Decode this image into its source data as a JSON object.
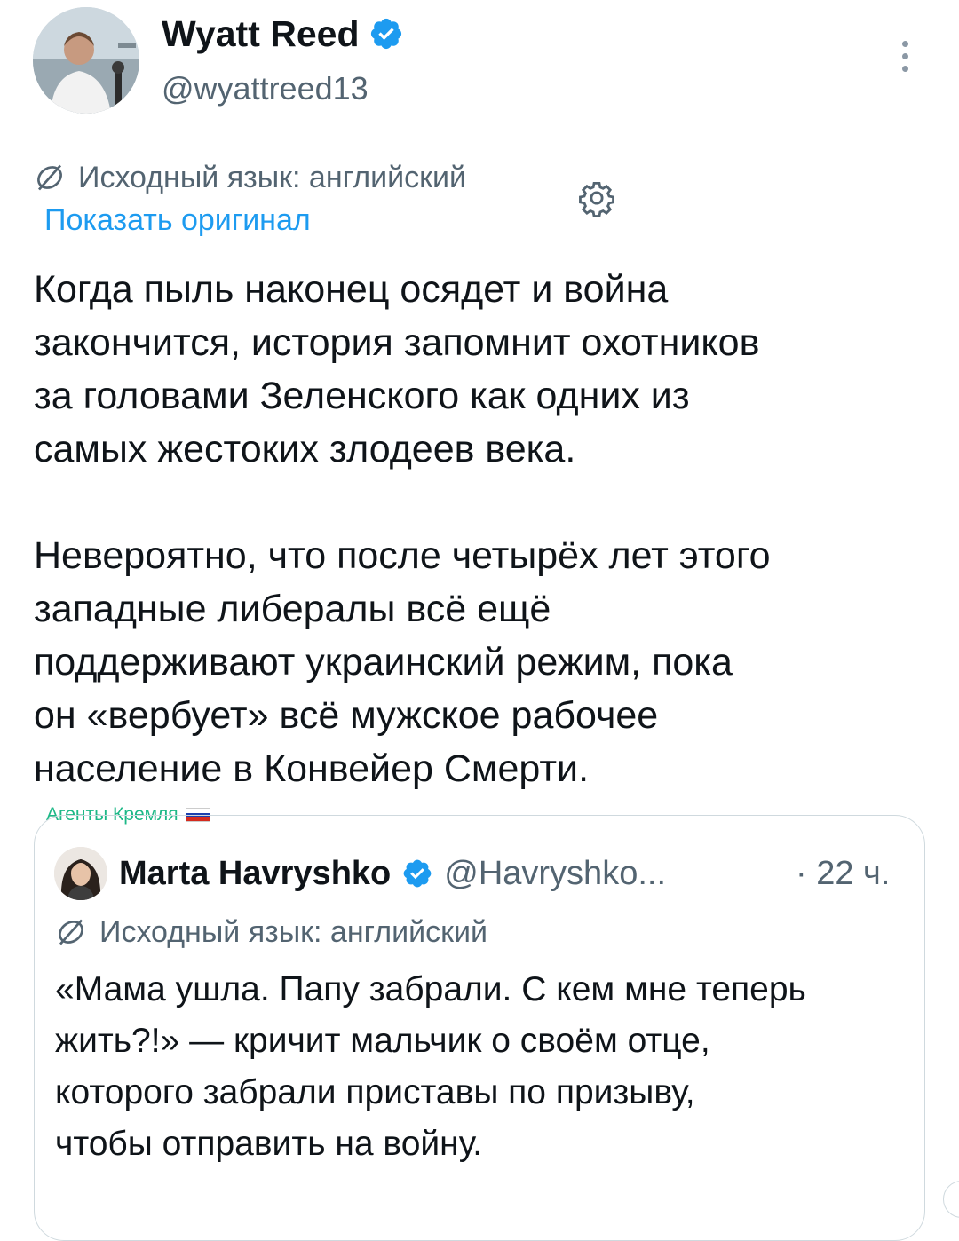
{
  "post": {
    "author": {
      "name": "Wyatt Reed",
      "handle": "@wyattreed13",
      "verified": true,
      "verified_color": "#1d9bf0"
    },
    "more_icon": "more-vertical-icon",
    "translation": {
      "icon": "translate-icon",
      "note": "Исходный язык: английский",
      "show_original": "Показать оригинал",
      "settings_icon": "gear-icon"
    },
    "text": "Когда пыль наконец осядет и война\nзакончится, история запомнит охотников\nза головами Зеленского как одних из\nсамых жестоких злодеев века.\n\nНевероятно, что после четырёх лет этого\nзападные либералы всё ещё\nподдерживают украинский режим, пока\nон «вербует» всё мужское рабочее\nнаселение в Конвейер Смерти.",
    "community_label": "Агенты Кремля",
    "community_color": "#1db887"
  },
  "quote": {
    "author": {
      "name": "Marta Havryshko",
      "handle": "@Havryshko...",
      "verified": true
    },
    "time": "· 22 ч.",
    "translation_note": "Исходный язык: английский",
    "text": "«Мама ушла. Папу забрали. С кем мне теперь\nжить?!» — кричит мальчик о своём отце,\nкоторого забрали приставы по призыву,\nчтобы отправить на войну."
  },
  "colors": {
    "text": "#0f1419",
    "secondary": "#536471",
    "link": "#1d9bf0",
    "border": "#cfd9de"
  }
}
